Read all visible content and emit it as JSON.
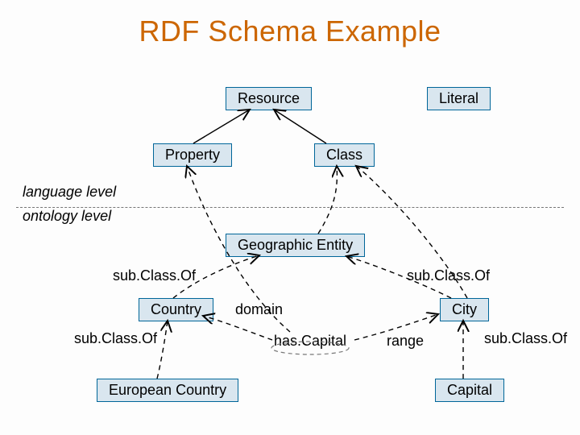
{
  "title": "RDF Schema Example",
  "boxes": {
    "resource": "Resource",
    "literal": "Literal",
    "property": "Property",
    "klass": "Class",
    "geo": "Geographic Entity",
    "country": "Country",
    "city": "City",
    "euro": "European Country",
    "capital": "Capital"
  },
  "labels": {
    "lang": "language level",
    "onto": "ontology level",
    "sc_left": "sub.Class.Of",
    "sc_right": "sub.Class.Of",
    "sc_bl": "sub.Class.Of",
    "sc_br": "sub.Class.Of",
    "domain": "domain",
    "hascap": "has.Capital",
    "range": "range"
  }
}
